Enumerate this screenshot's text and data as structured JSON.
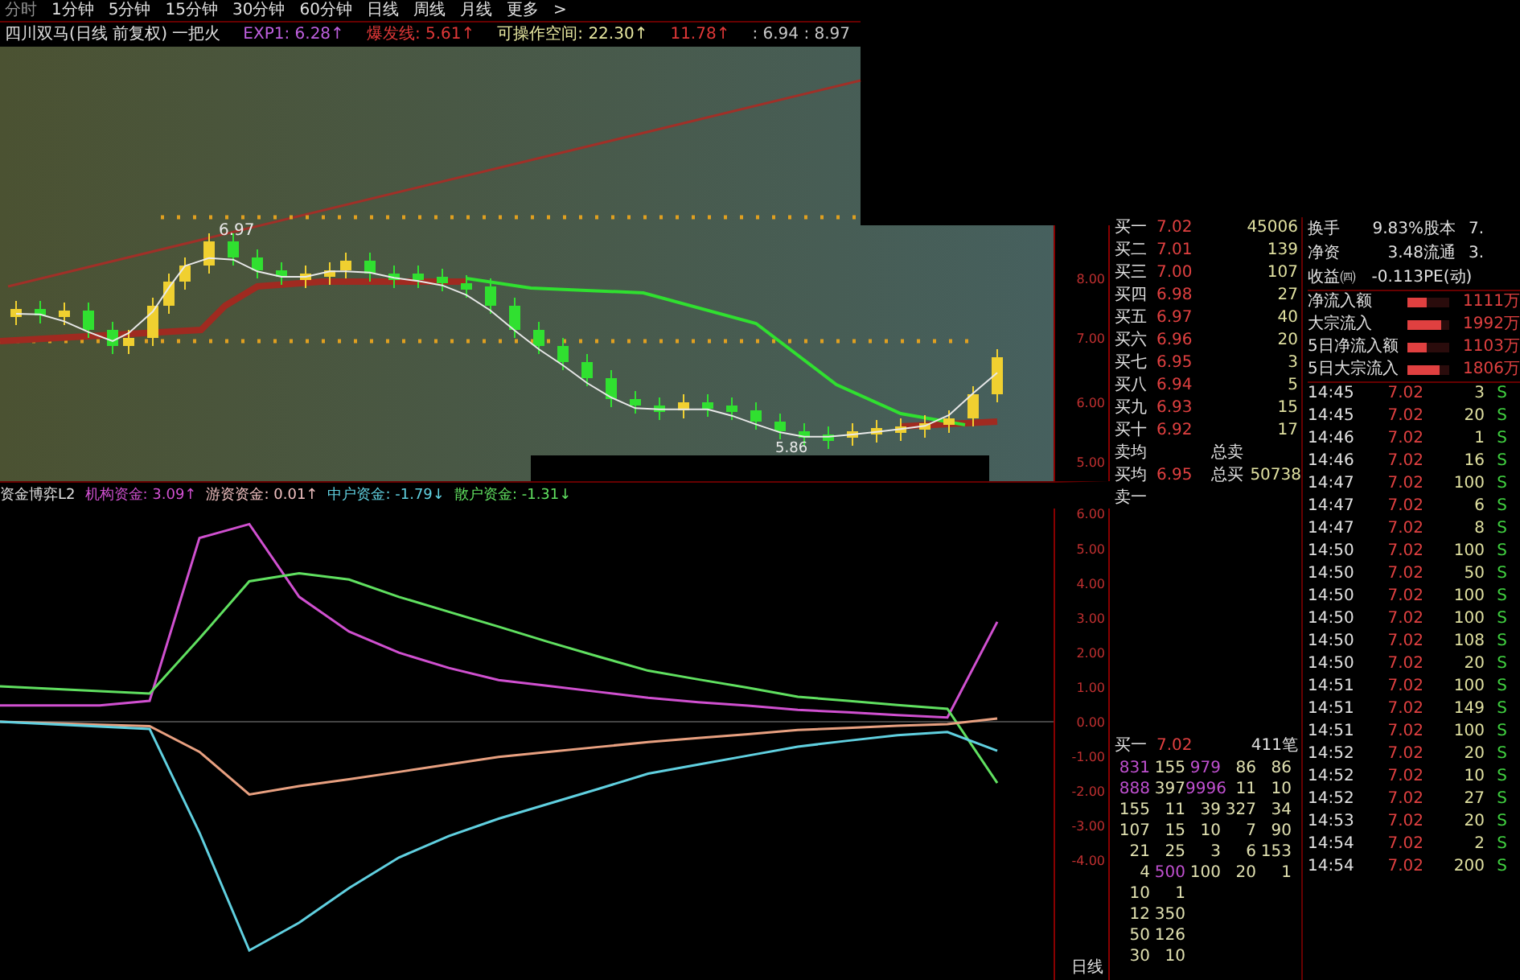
{
  "tabs": [
    {
      "label": "分时",
      "selected": true
    },
    {
      "label": "1分钟",
      "selected": false
    },
    {
      "label": "5分钟",
      "selected": false
    },
    {
      "label": "15分钟",
      "selected": false
    },
    {
      "label": "30分钟",
      "selected": false
    },
    {
      "label": "60分钟",
      "selected": false
    },
    {
      "label": "日线",
      "selected": false
    },
    {
      "label": "周线",
      "selected": false
    },
    {
      "label": "月线",
      "selected": false
    },
    {
      "label": "更多",
      "selected": false
    }
  ],
  "more_arrow": ">",
  "info_line": [
    {
      "text": "四川双马(日线 前复权) 一把火",
      "kind": "title"
    },
    {
      "text": "EXP1: 6.28↑",
      "kind": "exp"
    },
    {
      "text": "爆发线: 5.61↑",
      "kind": "burst"
    },
    {
      "text": "可操作空间: 22.30↑",
      "kind": "space"
    },
    {
      "text": "11.78↑",
      "kind": "target"
    },
    {
      "text": ": 6.94 : 8.97",
      "kind": "range"
    }
  ],
  "price_chart": {
    "high_label": "6.97",
    "low_label": "5.86",
    "y_axis": [
      "8.00",
      "7.00",
      "6.00",
      "5.00"
    ]
  },
  "indicator": {
    "title": "资金博弈L2",
    "legend": [
      {
        "text": "机构资金: 3.09↑",
        "color": "#d050d0"
      },
      {
        "text": "游资资金: 0.01↑",
        "color": "#f0c0c0"
      },
      {
        "text": "中户资金: -1.79↓",
        "color": "#60d0e0"
      },
      {
        "text": "散户资金: -1.31↓",
        "color": "#60e060"
      }
    ],
    "period": "日线",
    "chart_data": {
      "type": "line",
      "ylim": [
        -7.5,
        6.15
      ],
      "yticks": [
        {
          "value": 6,
          "label": "6.00"
        },
        {
          "value": 5,
          "label": "5.00"
        },
        {
          "value": 4,
          "label": "4.00"
        },
        {
          "value": 3,
          "label": "3.00"
        },
        {
          "value": 2,
          "label": "2.00"
        },
        {
          "value": 1,
          "label": "1.00"
        },
        {
          "value": 0,
          "label": "0.00"
        },
        {
          "value": -1,
          "label": "-1.00"
        },
        {
          "value": -2,
          "label": "-2.00"
        },
        {
          "value": -3,
          "label": "-3.00"
        },
        {
          "value": -4,
          "label": "-4.00"
        }
      ],
      "series": [
        {
          "color": "#d050d0",
          "values": [
            0.47,
            0.47,
            0.47,
            0.6,
            5.3,
            5.7,
            3.6,
            2.6,
            1.99,
            1.55,
            1.2,
            1.03,
            0.86,
            0.69,
            0.56,
            0.46,
            0.34,
            0.27,
            0.19,
            0.12,
            2.88
          ]
        },
        {
          "color": "#60e060",
          "values": [
            1.02,
            0.95,
            0.88,
            0.81,
            2.4,
            4.05,
            4.28,
            4.1,
            3.6,
            3.17,
            2.74,
            2.3,
            1.88,
            1.47,
            1.22,
            0.98,
            0.72,
            0.6,
            0.48,
            0.37,
            -1.77
          ]
        },
        {
          "color": "#e8a080",
          "values": [
            0,
            -0.04,
            -0.09,
            -0.13,
            -0.87,
            -2.1,
            -1.86,
            -1.66,
            -1.45,
            -1.23,
            -1.02,
            -0.87,
            -0.73,
            -0.59,
            -0.47,
            -0.36,
            -0.24,
            -0.18,
            -0.12,
            -0.07,
            0.09
          ]
        },
        {
          "color": "#60d0e0",
          "values": [
            0,
            -0.07,
            -0.14,
            -0.21,
            -3.2,
            -6.6,
            -5.8,
            -4.8,
            -3.92,
            -3.3,
            -2.8,
            -2.37,
            -1.94,
            -1.5,
            -1.24,
            -0.98,
            -0.72,
            -0.55,
            -0.39,
            -0.3,
            -0.84
          ]
        }
      ]
    }
  },
  "order_book": {
    "bids": [
      {
        "label": "买一",
        "price": "7.02",
        "volume": "45006"
      },
      {
        "label": "买二",
        "price": "7.01",
        "volume": "139"
      },
      {
        "label": "买三",
        "price": "7.00",
        "volume": "107"
      },
      {
        "label": "买四",
        "price": "6.98",
        "volume": "27"
      },
      {
        "label": "买五",
        "price": "6.97",
        "volume": "40"
      },
      {
        "label": "买六",
        "price": "6.96",
        "volume": "20"
      },
      {
        "label": "买七",
        "price": "6.95",
        "volume": "3"
      },
      {
        "label": "买八",
        "price": "6.94",
        "volume": "5"
      },
      {
        "label": "买九",
        "price": "6.93",
        "volume": "15"
      },
      {
        "label": "买十",
        "price": "6.92",
        "volume": "17"
      }
    ],
    "summary": [
      {
        "label": "卖均",
        "total_label": "总卖"
      },
      {
        "label": "买均",
        "price": "6.95",
        "total_label": "总买",
        "total": "50738"
      },
      {
        "label": "卖一"
      }
    ]
  },
  "queue": {
    "label": "买一",
    "price": "7.02",
    "count": "411笔",
    "rows": [
      {
        "cells": [
          {
            "text": "831",
            "highlight": true
          },
          {
            "text": "155",
            "highlight": false
          },
          {
            "text": "979",
            "highlight": true
          },
          {
            "text": "86",
            "highlight": false
          },
          {
            "text": "86",
            "highlight": false
          }
        ]
      },
      {
        "cells": [
          {
            "text": "888",
            "highlight": true
          },
          {
            "text": "397",
            "highlight": false
          },
          {
            "text": "9996",
            "highlight": true
          },
          {
            "text": "11",
            "highlight": false
          },
          {
            "text": "10",
            "highlight": false
          }
        ]
      },
      {
        "cells": [
          {
            "text": "155",
            "highlight": false
          },
          {
            "text": "11",
            "highlight": false
          },
          {
            "text": "39",
            "highlight": false
          },
          {
            "text": "327",
            "highlight": false
          },
          {
            "text": "34",
            "highlight": false
          }
        ]
      },
      {
        "cells": [
          {
            "text": "107",
            "highlight": false
          },
          {
            "text": "15",
            "highlight": false
          },
          {
            "text": "10",
            "highlight": false
          },
          {
            "text": "7",
            "highlight": false
          },
          {
            "text": "90",
            "highlight": false
          }
        ]
      },
      {
        "cells": [
          {
            "text": "21",
            "highlight": false
          },
          {
            "text": "25",
            "highlight": false
          },
          {
            "text": "3",
            "highlight": false
          },
          {
            "text": "6",
            "highlight": false
          },
          {
            "text": "153",
            "highlight": false
          }
        ]
      },
      {
        "cells": [
          {
            "text": "4",
            "highlight": false
          },
          {
            "text": "500",
            "highlight": true
          },
          {
            "text": "100",
            "highlight": false
          },
          {
            "text": "20",
            "highlight": false
          },
          {
            "text": "1",
            "highlight": false
          }
        ]
      },
      {
        "cells": [
          {
            "text": "10",
            "highlight": false
          },
          {
            "text": "1",
            "highlight": false
          }
        ]
      },
      {
        "cells": [
          {
            "text": "12",
            "highlight": false
          },
          {
            "text": "350",
            "highlight": false
          }
        ]
      },
      {
        "cells": [
          {
            "text": "50",
            "highlight": false
          },
          {
            "text": "126",
            "highlight": false
          }
        ]
      },
      {
        "cells": [
          {
            "text": "30",
            "highlight": false
          },
          {
            "text": "10",
            "highlight": false
          }
        ]
      }
    ]
  },
  "stats": [
    {
      "label": "换手",
      "value": "9.83%",
      "label2": "股本",
      "value2": "7."
    },
    {
      "label": "净资",
      "value": "3.48",
      "label2": "流通",
      "value2": "3."
    },
    {
      "label": "收益㈣",
      "value": "-0.113",
      "label2": "PE(动)"
    }
  ],
  "flows": [
    {
      "label": "净流入额",
      "level": 0.45,
      "value": "1111万"
    },
    {
      "label": "大宗流入",
      "level": 0.8,
      "value": "1992万"
    },
    {
      "label": "5日净流入额",
      "level": 0.45,
      "value": "1103万"
    },
    {
      "label": "5日大宗流入",
      "level": 0.75,
      "value": "1806万"
    }
  ],
  "ticks": [
    {
      "time": "14:45",
      "price": "7.02",
      "volume": "3",
      "side": "S"
    },
    {
      "time": "14:45",
      "price": "7.02",
      "volume": "20",
      "side": "S"
    },
    {
      "time": "14:46",
      "price": "7.02",
      "volume": "1",
      "side": "S"
    },
    {
      "time": "14:46",
      "price": "7.02",
      "volume": "16",
      "side": "S"
    },
    {
      "time": "14:47",
      "price": "7.02",
      "volume": "100",
      "side": "S"
    },
    {
      "time": "14:47",
      "price": "7.02",
      "volume": "6",
      "side": "S"
    },
    {
      "time": "14:47",
      "price": "7.02",
      "volume": "8",
      "side": "S"
    },
    {
      "time": "14:50",
      "price": "7.02",
      "volume": "100",
      "side": "S"
    },
    {
      "time": "14:50",
      "price": "7.02",
      "volume": "50",
      "side": "S"
    },
    {
      "time": "14:50",
      "price": "7.02",
      "volume": "100",
      "side": "S"
    },
    {
      "time": "14:50",
      "price": "7.02",
      "volume": "100",
      "side": "S"
    },
    {
      "time": "14:50",
      "price": "7.02",
      "volume": "108",
      "side": "S"
    },
    {
      "time": "14:50",
      "price": "7.02",
      "volume": "20",
      "side": "S"
    },
    {
      "time": "14:51",
      "price": "7.02",
      "volume": "100",
      "side": "S"
    },
    {
      "time": "14:51",
      "price": "7.02",
      "volume": "149",
      "side": "S"
    },
    {
      "time": "14:51",
      "price": "7.02",
      "volume": "100",
      "side": "S"
    },
    {
      "time": "14:52",
      "price": "7.02",
      "volume": "20",
      "side": "S"
    },
    {
      "time": "14:52",
      "price": "7.02",
      "volume": "10",
      "side": "S"
    },
    {
      "time": "14:52",
      "price": "7.02",
      "volume": "27",
      "side": "S"
    },
    {
      "time": "14:53",
      "price": "7.02",
      "volume": "20",
      "side": "S"
    },
    {
      "time": "14:54",
      "price": "7.02",
      "volume": "2",
      "side": "S"
    },
    {
      "time": "14:54",
      "price": "7.02",
      "volume": "200",
      "side": "S"
    }
  ]
}
